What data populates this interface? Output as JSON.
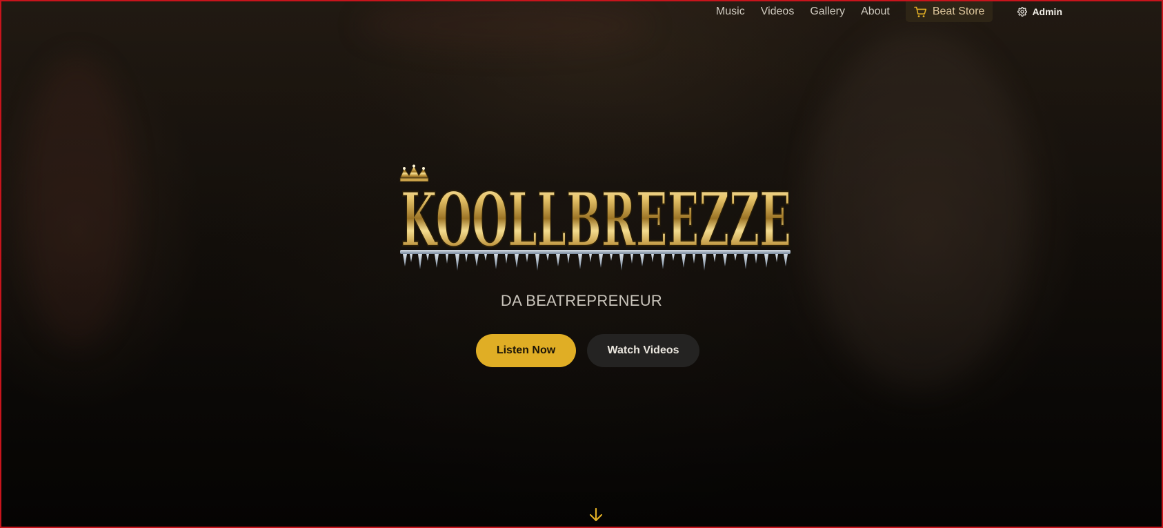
{
  "nav": {
    "items": [
      {
        "label": "Music"
      },
      {
        "label": "Videos"
      },
      {
        "label": "Gallery"
      },
      {
        "label": "About"
      }
    ],
    "store": {
      "label": "Beat Store",
      "icon": "cart-icon"
    },
    "admin": {
      "label": "Admin",
      "icon": "gear-icon"
    }
  },
  "hero": {
    "logo_text": "KOOLLBREEZZE",
    "tagline": "DA BEATREPRENEUR",
    "primary_cta": "Listen Now",
    "secondary_cta": "Watch Videos",
    "scroll_icon": "arrow-down-icon"
  },
  "colors": {
    "accent": "#e0ae25",
    "store_bg": "#2e2516",
    "secondary_btn": "#242322",
    "background": "#17120d"
  }
}
